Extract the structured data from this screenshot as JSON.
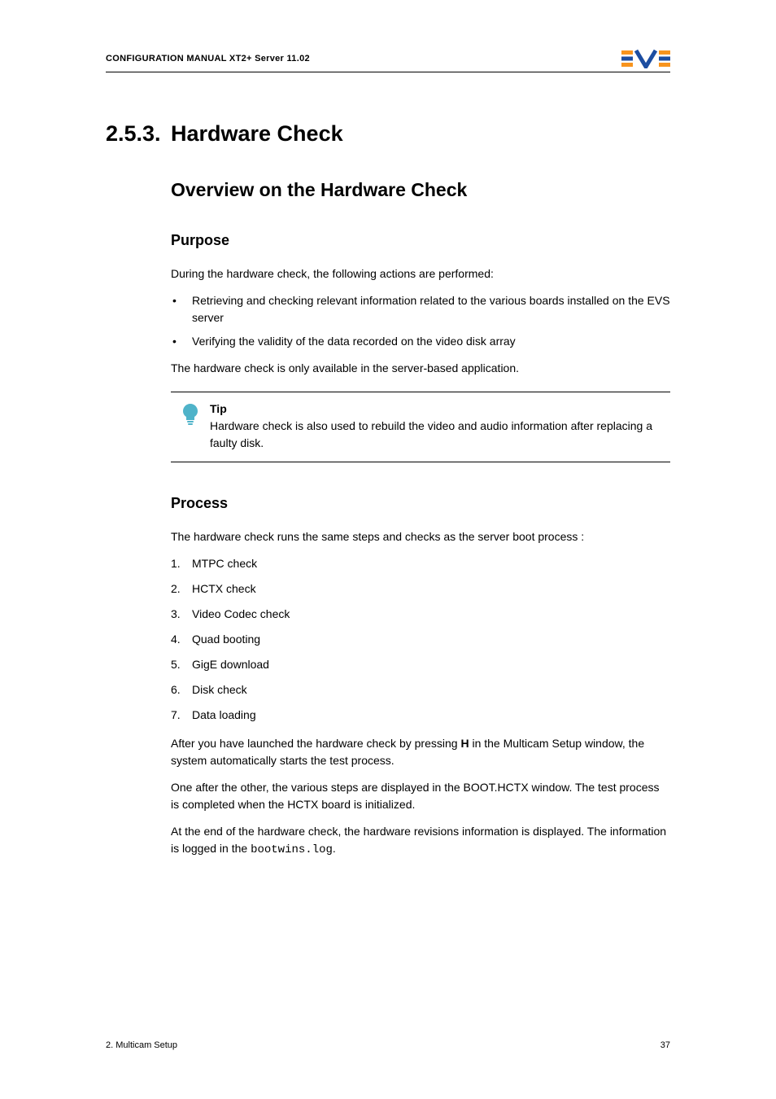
{
  "header": {
    "title": "CONFIGURATION MANUAL  XT2+ Server 11.02"
  },
  "section": {
    "number": "2.5.3.",
    "title": "Hardware Check"
  },
  "h2": "Overview on the Hardware Check",
  "purpose": {
    "heading": "Purpose",
    "intro": "During the hardware check, the following actions are performed:",
    "bullets": [
      "Retrieving and checking relevant information related to the various boards installed on the EVS server",
      "Verifying the validity of the data recorded on the video disk array"
    ],
    "after": "The hardware check is only available in the server-based application."
  },
  "tip": {
    "label": "Tip",
    "text": "Hardware check is also used to rebuild the video and audio information after replacing a faulty disk."
  },
  "process": {
    "heading": "Process",
    "intro": "The hardware check runs the same steps and checks as the server boot process :",
    "items": [
      "MTPC check",
      "HCTX check",
      "Video Codec check",
      "Quad booting",
      "GigE download",
      "Disk check",
      "Data loading"
    ],
    "para1_pre": "After you have launched the hardware check by pressing ",
    "para1_key": "H",
    "para1_post": " in the Multicam Setup window, the system automatically starts the test process.",
    "para2": "One after the other, the various steps are displayed in the BOOT.HCTX window. The test process is completed when the HCTX  board is initialized.",
    "para3_pre": "At the end of the hardware check, the hardware revisions information is displayed. The information is logged in the ",
    "para3_code": "bootwins.log",
    "para3_post": "."
  },
  "footer": {
    "left": "2. Multicam Setup",
    "right": "37"
  }
}
